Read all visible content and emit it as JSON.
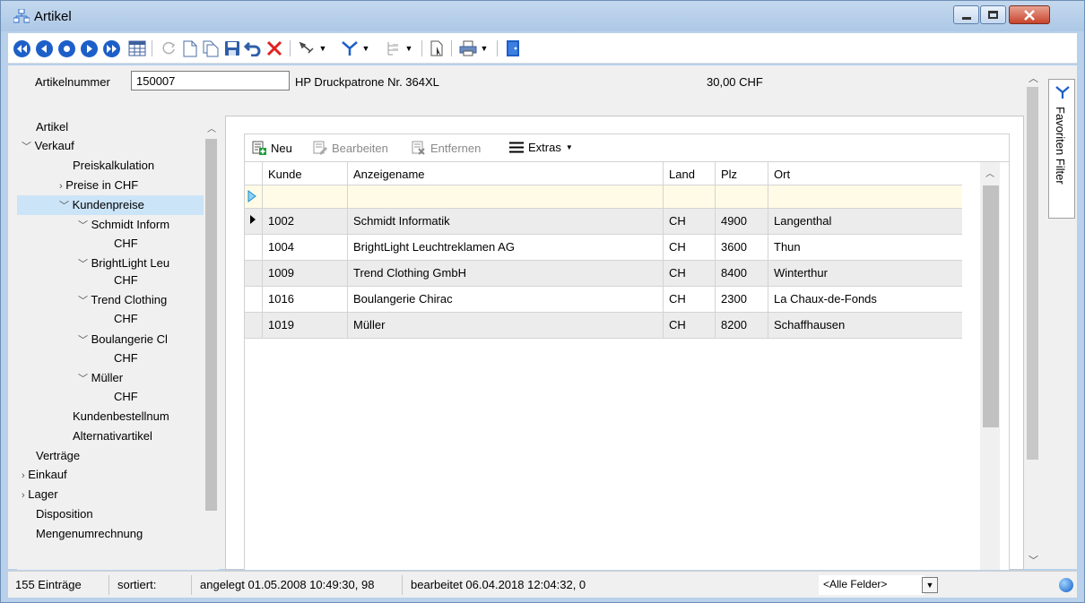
{
  "window": {
    "title": "Artikel"
  },
  "header": {
    "artnr_label": "Artikelnummer",
    "artnr_value": "150007",
    "article_name": "HP Druckpatrone Nr. 364XL",
    "article_price": "30,00 CHF"
  },
  "tree": {
    "items": [
      {
        "label": "Artikel"
      },
      {
        "label": "Verkauf"
      },
      {
        "label": "Preiskalkulation"
      },
      {
        "label": "Preise in CHF"
      },
      {
        "label": "Kundenpreise"
      },
      {
        "label": "Schmidt Inform"
      },
      {
        "label": "CHF"
      },
      {
        "label": "BrightLight Leu"
      },
      {
        "label": "CHF"
      },
      {
        "label": "Trend Clothing"
      },
      {
        "label": "CHF"
      },
      {
        "label": "Boulangerie Cl"
      },
      {
        "label": "CHF"
      },
      {
        "label": "Müller"
      },
      {
        "label": "CHF"
      },
      {
        "label": "Kundenbestellnum"
      },
      {
        "label": "Alternativartikel"
      },
      {
        "label": "Verträge"
      },
      {
        "label": "Einkauf"
      },
      {
        "label": "Lager"
      },
      {
        "label": "Disposition"
      },
      {
        "label": "Mengenumrechnung"
      }
    ]
  },
  "grid_toolbar": {
    "new": "Neu",
    "edit": "Bearbeiten",
    "remove": "Entfernen",
    "extras": "Extras"
  },
  "grid": {
    "columns": [
      "Kunde",
      "Anzeigename",
      "Land",
      "Plz",
      "Ort"
    ],
    "rows": [
      [
        "1002",
        "Schmidt Informatik",
        "CH",
        "4900",
        "Langenthal"
      ],
      [
        "1004",
        "BrightLight Leuchtreklamen AG",
        "CH",
        "3600",
        "Thun"
      ],
      [
        "1009",
        "Trend Clothing GmbH",
        "CH",
        "8400",
        "Winterthur"
      ],
      [
        "1016",
        "Boulangerie Chirac",
        "CH",
        "2300",
        "La Chaux-de-Fonds"
      ],
      [
        "1019",
        "Müller",
        "CH",
        "8200",
        "Schaffhausen"
      ]
    ]
  },
  "side_tab": {
    "label": "Favoriten Filter"
  },
  "status": {
    "count": "155 Einträge",
    "sorted": "sortiert:",
    "created": "angelegt 01.05.2008 10:49:30, 98",
    "edited": "bearbeitet 06.04.2018 12:04:32,  0",
    "field_select": "<Alle Felder>"
  },
  "colors": {
    "accent": "#1d5fc9",
    "selected": "#cce4f7",
    "new_row": "#fffbe6"
  }
}
